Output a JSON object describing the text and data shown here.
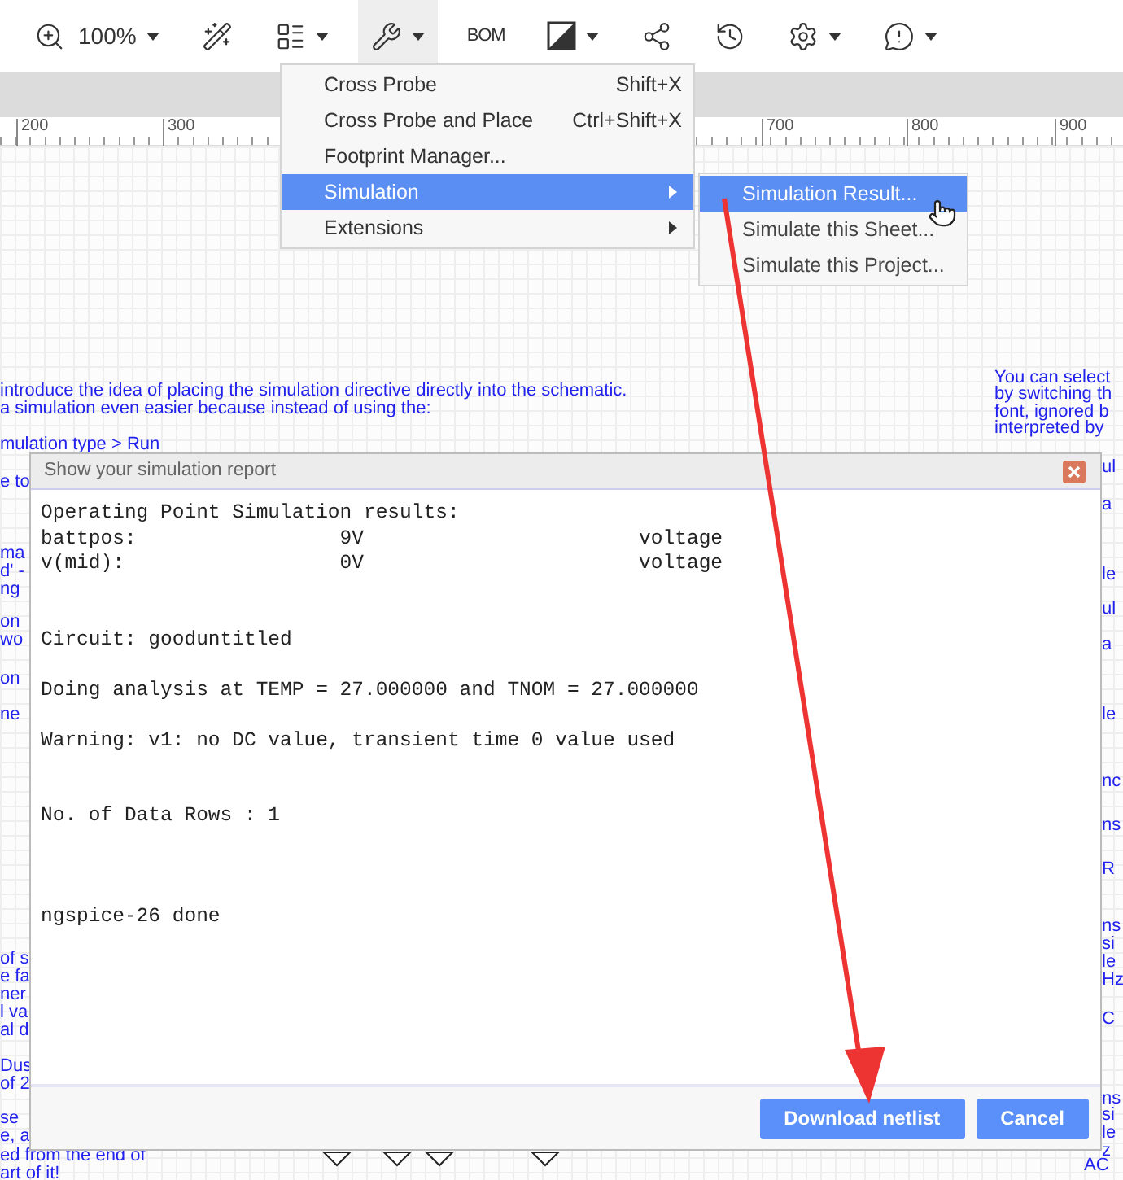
{
  "toolbar": {
    "items": [
      {
        "kind": "zoom",
        "label": "100%",
        "dropdown": true,
        "selected": false
      },
      {
        "kind": "wand",
        "dropdown": false,
        "selected": false
      },
      {
        "kind": "panel",
        "dropdown": true,
        "selected": false
      },
      {
        "kind": "tools",
        "dropdown": true,
        "selected": true
      },
      {
        "kind": "text",
        "label": "BOM",
        "dropdown": false,
        "selected": false
      },
      {
        "kind": "theme",
        "dropdown": true,
        "selected": false
      },
      {
        "kind": "share",
        "dropdown": false,
        "selected": false
      },
      {
        "kind": "history",
        "dropdown": false,
        "selected": false
      },
      {
        "kind": "settings",
        "dropdown": true,
        "selected": false
      },
      {
        "kind": "feedback",
        "dropdown": true,
        "selected": false
      }
    ]
  },
  "ruler": {
    "labels": [
      "200",
      "300",
      "700",
      "800",
      "900"
    ]
  },
  "menu": {
    "items": [
      {
        "label": "Cross Probe",
        "shortcut": "Shift+X",
        "submenu": false,
        "selected": false
      },
      {
        "label": "Cross Probe and Place",
        "shortcut": "Ctrl+Shift+X",
        "submenu": false,
        "selected": false
      },
      {
        "label": "Footprint Manager...",
        "submenu": false,
        "selected": false
      },
      {
        "label": "Simulation",
        "submenu": true,
        "selected": true
      },
      {
        "label": "Extensions",
        "submenu": true,
        "selected": false
      }
    ]
  },
  "submenu": {
    "items": [
      {
        "label": "Simulation Result...",
        "selected": true
      },
      {
        "label": "Simulate this Sheet...",
        "selected": false
      },
      {
        "label": "Simulate this Project...",
        "selected": false
      }
    ]
  },
  "canvas_notes": [
    {
      "text": "introduce the idea of placing the simulation directive directly into the schematic."
    },
    {
      "text": "a simulation even easier because instead of using the:"
    },
    {
      "text": "mulation type > Run"
    },
    {
      "text": "e to"
    },
    {
      "text": "You can select"
    },
    {
      "text": "by switching th"
    },
    {
      "text": "font, ignored b"
    },
    {
      "text": "interpreted by"
    },
    {
      "text": "ma"
    },
    {
      "text": "d' -"
    },
    {
      "text": "ng"
    },
    {
      "text": "on"
    },
    {
      "text": "wo"
    },
    {
      "text": "on"
    },
    {
      "text": "ne"
    },
    {
      "text": "of s"
    },
    {
      "text": "e fa"
    },
    {
      "text": "ner"
    },
    {
      "text": "l va"
    },
    {
      "text": "al d"
    },
    {
      "text": "Dus"
    },
    {
      "text": "of 2"
    },
    {
      "text": "se"
    },
    {
      "text": "e, a"
    },
    {
      "text": "ed from the end of"
    },
    {
      "text": "art of it!"
    },
    {
      "text": "ul"
    },
    {
      "text": "a"
    },
    {
      "text": "le"
    },
    {
      "text": "ul"
    },
    {
      "text": "a"
    },
    {
      "text": "le"
    },
    {
      "text": "nc"
    },
    {
      "text": "ns"
    },
    {
      "text": "R"
    },
    {
      "text": "ns"
    },
    {
      "text": "si"
    },
    {
      "text": "le"
    },
    {
      "text": "Hz"
    },
    {
      "text": "C"
    },
    {
      "text": "ns"
    },
    {
      "text": "si"
    },
    {
      "text": "le"
    },
    {
      "text": "z"
    },
    {
      "text": "AC"
    }
  ],
  "dialog": {
    "title": "Show your simulation report",
    "report": "Operating Point Simulation results:\nbattpos:                 9V                       voltage\nv(mid):                  0V                       voltage\n\n\nCircuit: gooduntitled\n\nDoing analysis at TEMP = 27.000000 and TNOM = 27.000000\n\nWarning: v1: no DC value, transient time 0 value used\n\n\nNo. of Data Rows : 1\n\n\n\nngspice-26 done",
    "buttons": [
      "Download netlist",
      "Cancel"
    ]
  }
}
